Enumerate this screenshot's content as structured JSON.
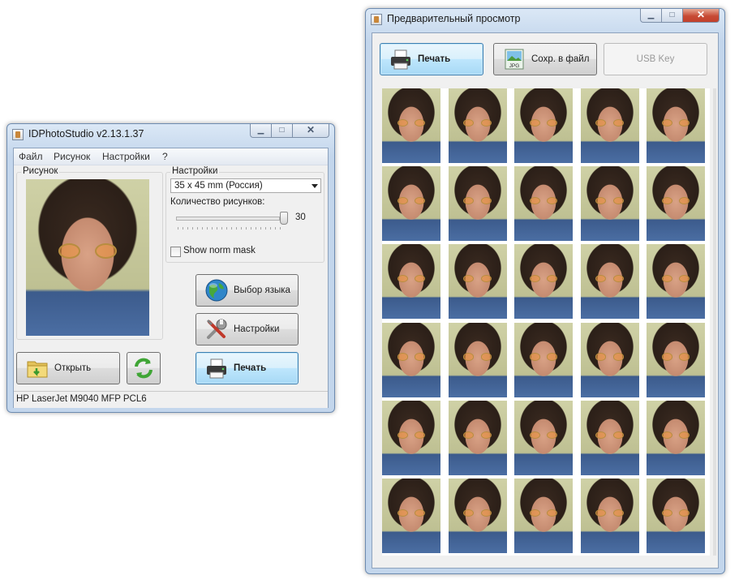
{
  "main_window": {
    "title": "IDPhotoStudio v2.13.1.37",
    "menu": [
      "Файл",
      "Рисунок",
      "Настройки",
      "?"
    ],
    "picture_group_label": "Рисунок",
    "settings_group_label": "Настройки",
    "format_selected": "35 x 45 mm (Россия)",
    "count_label": "Количество рисунков:",
    "count_value": "30",
    "slider_fraction": 1.0,
    "show_norm_mask_label": "Show norm mask",
    "show_norm_mask_checked": false,
    "language_button": "Выбор языка",
    "settings_button": "Настройки",
    "open_button": "Открыть",
    "print_button": "Печать",
    "status_printer": "HP LaserJet M9040 MFP PCL6",
    "icons": {
      "language": "globe-icon",
      "settings": "tools-icon",
      "open": "open-folder-icon",
      "refresh": "refresh-icon",
      "print": "printer-icon"
    }
  },
  "preview_window": {
    "title": "Предварительный просмотр",
    "print_button": "Печать",
    "save_button": "Сохр. в файл",
    "usb_key_button": "USB Key",
    "photo_count": 30,
    "grid_columns": 5,
    "grid_rows": 6,
    "icons": {
      "print": "printer-icon",
      "save": "jpg-file-icon"
    }
  },
  "colors": {
    "title_bar": "#c3d6ec",
    "close_button": "#c74b35",
    "focus_button": "#a7d9f5"
  }
}
